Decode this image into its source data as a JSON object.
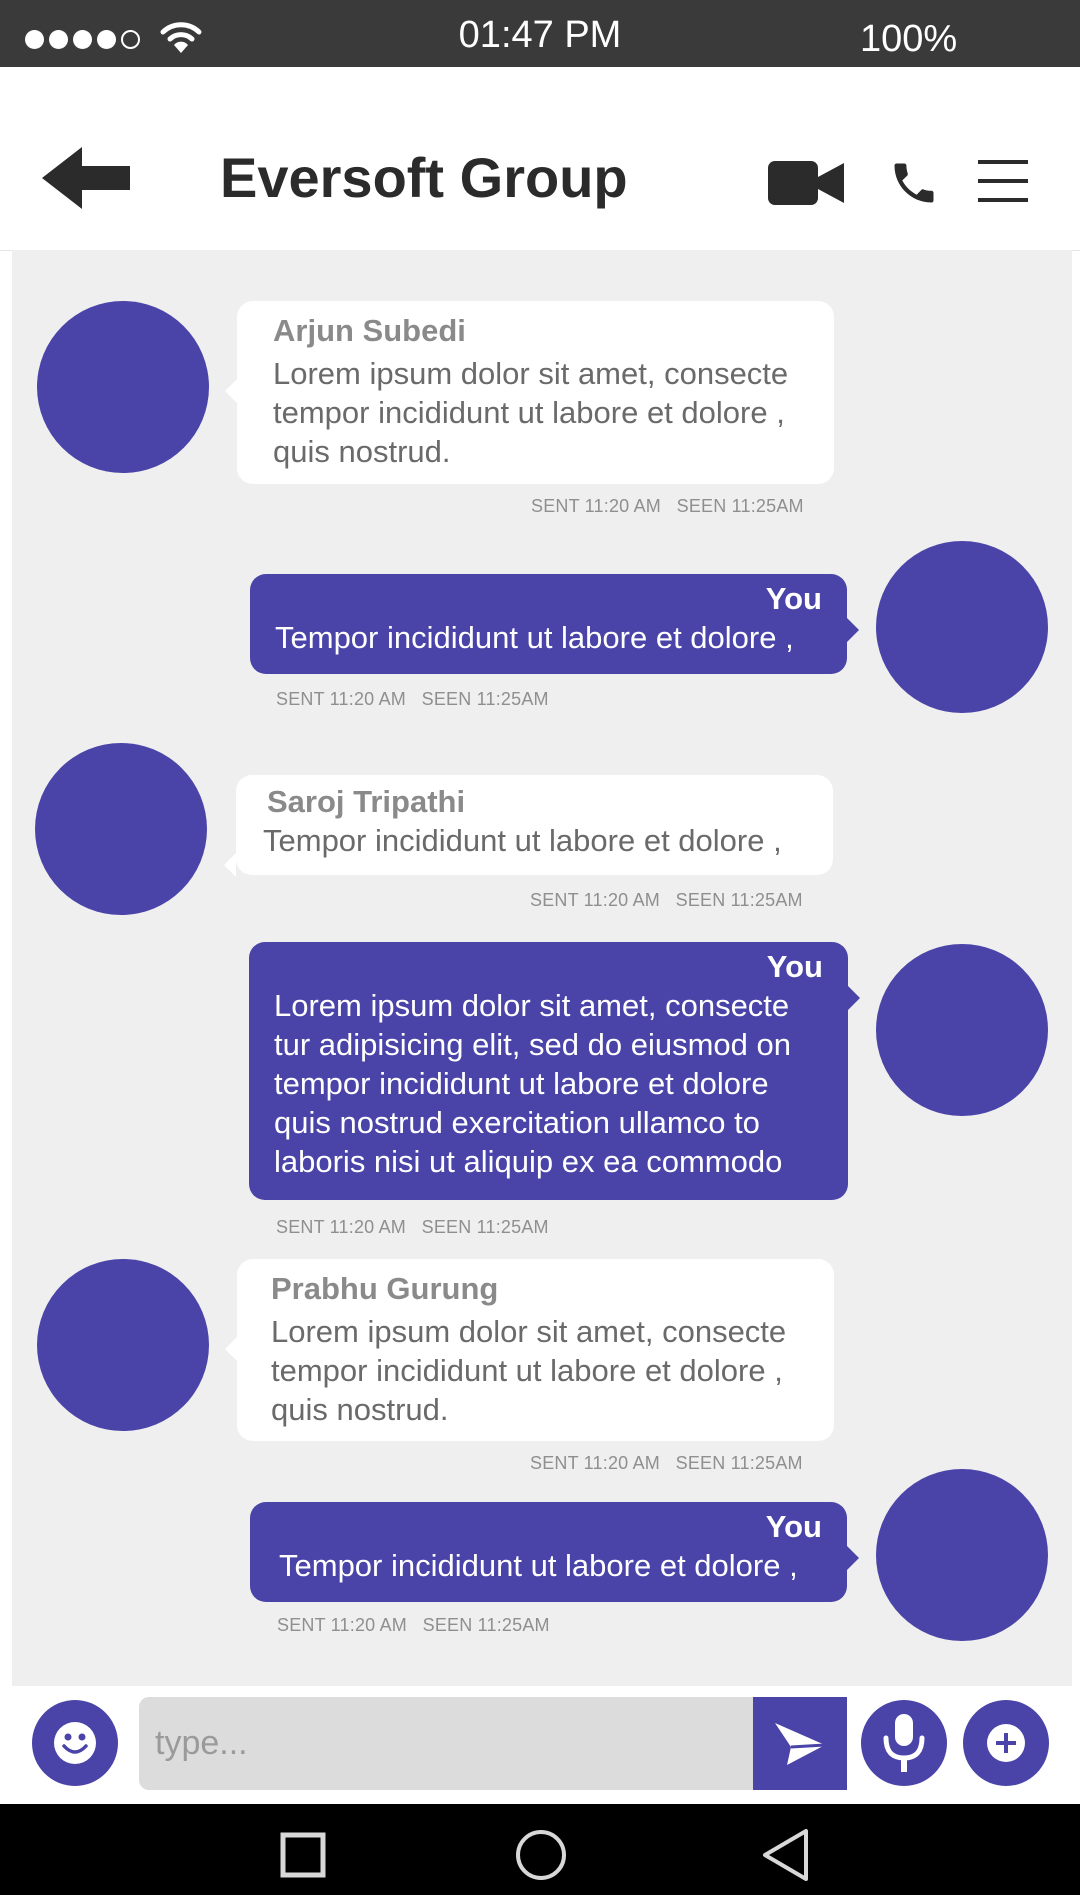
{
  "status_bar": {
    "time": "01:47 PM",
    "battery": "100%",
    "signal_strength": "4 of 5"
  },
  "header": {
    "title": "Eversoft Group"
  },
  "messages": [
    {
      "direction": "in",
      "sender": "Arjun Subedi",
      "text": "Lorem ipsum dolor sit amet, consecte\ntempor incididunt ut labore et dolore ,\nquis nostrud.",
      "sent": "SENT 11:20 AM",
      "seen": "SEEN 11:25AM"
    },
    {
      "direction": "out",
      "sender": "You",
      "text": "Tempor incididunt ut labore et dolore ,",
      "sent": "SENT 11:20 AM",
      "seen": "SEEN 11:25AM"
    },
    {
      "direction": "in",
      "sender": "Saroj Tripathi",
      "text": "Tempor incididunt ut labore et dolore ,",
      "sent": "SENT 11:20 AM",
      "seen": "SEEN 11:25AM"
    },
    {
      "direction": "out",
      "sender": "You",
      "text": "Lorem ipsum dolor sit amet, consecte\ntur adipisicing elit, sed do eiusmod on\ntempor incididunt ut labore et dolore\nquis nostrud exercitation ullamco to\nlaboris nisi ut aliquip ex ea commodo",
      "sent": "SENT 11:20 AM",
      "seen": "SEEN 11:25AM"
    },
    {
      "direction": "in",
      "sender": "Prabhu Gurung",
      "text": "Lorem ipsum dolor sit amet, consecte\ntempor incididunt ut labore et dolore ,\nquis nostrud.",
      "sent": "SENT 11:20 AM",
      "seen": "SEEN 11:25AM"
    },
    {
      "direction": "out",
      "sender": "You",
      "text": "Tempor incididunt ut labore et dolore ,",
      "sent": "SENT 11:20 AM",
      "seen": "SEEN 11:25AM"
    }
  ],
  "composer": {
    "placeholder": "type..."
  },
  "icons": {
    "back": "back-arrow-icon",
    "video": "video-camera-icon",
    "call": "phone-icon",
    "menu": "hamburger-menu-icon",
    "emoji": "smiley-icon",
    "send": "send-icon",
    "mic": "microphone-icon",
    "add": "plus-icon",
    "nav_recent": "square-icon",
    "nav_home": "circle-icon",
    "nav_back": "triangle-back-icon"
  },
  "colors": {
    "accent": "#4a43a8",
    "status_bar": "#3a3a3a",
    "chat_bg": "#efefef"
  }
}
